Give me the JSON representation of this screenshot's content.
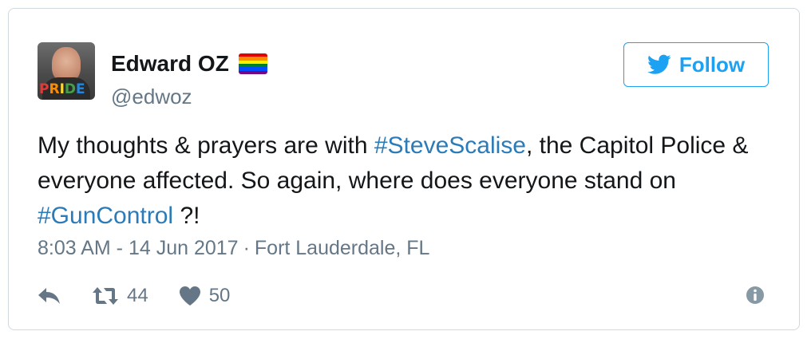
{
  "user": {
    "display_name": "Edward OZ",
    "handle": "@edwoz",
    "name_emoji": "rainbow-flag-icon",
    "avatar_label": "PRIDE"
  },
  "follow_button": {
    "label": "Follow"
  },
  "tweet": {
    "text_part1": "My thoughts & prayers are with ",
    "hashtag1": "#SteveScalise",
    "text_part2": ", the Capitol Police & everyone affected. So again, where does everyone stand on ",
    "hashtag2": "#GunControl",
    "text_part3": " ?!"
  },
  "meta": {
    "time": "8:03 AM - 14 Jun 2017",
    "separator": "·",
    "location": "Fort Lauderdale, FL"
  },
  "actions": {
    "retweet_count": "44",
    "like_count": "50"
  },
  "colors": {
    "accent": "#1da1f2",
    "hashtag": "#2b7bb9",
    "text": "#14171a",
    "muted": "#657786",
    "border": "#cfd9de"
  }
}
